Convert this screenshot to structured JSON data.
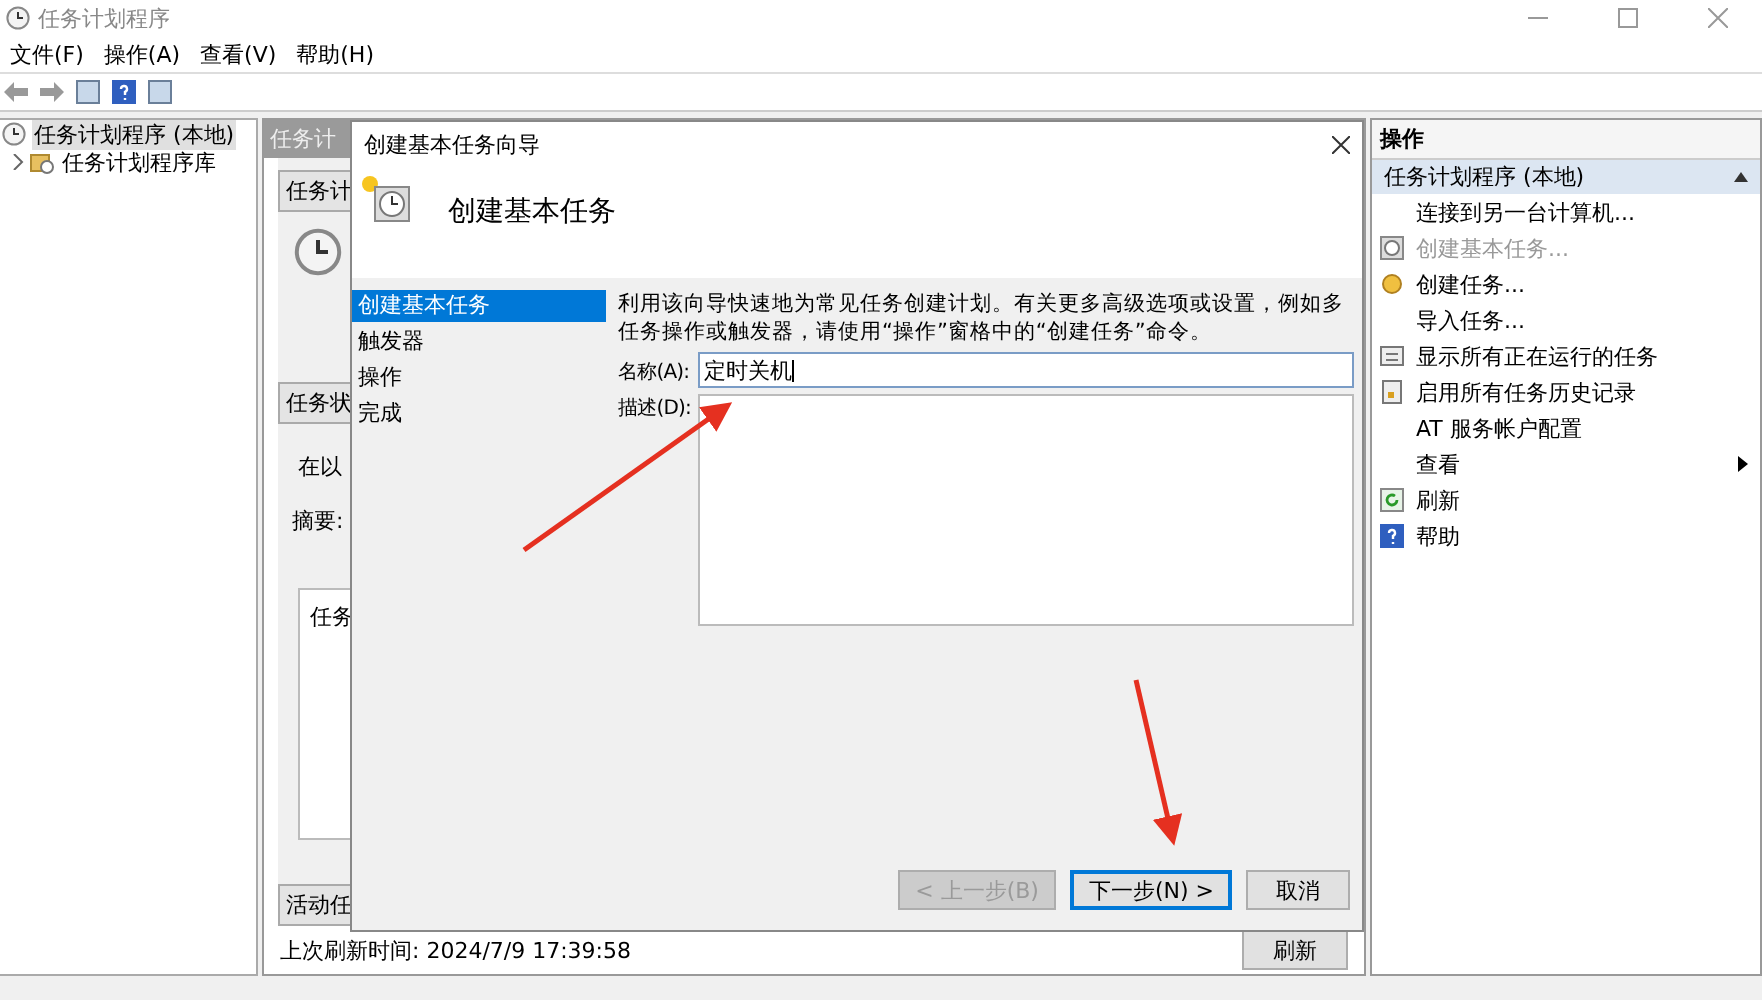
{
  "window": {
    "title": "任务计划程序"
  },
  "menu": [
    {
      "label": "文件(F)"
    },
    {
      "label": "操作(A)"
    },
    {
      "label": "查看(V)"
    },
    {
      "label": "帮助(H)"
    }
  ],
  "tree": [
    {
      "label": "任务计划程序 (本地)",
      "selected": true,
      "children": [
        {
          "label": "任务计划程序库",
          "selected": false,
          "expanded": false
        }
      ]
    }
  ],
  "middle": {
    "header": "任务计",
    "section_1": "任务计",
    "section_2": "任务状",
    "line_1": "在以",
    "summary_label": "摘要:",
    "list_text": "任务",
    "section_3": "活动任",
    "status": "上次刷新时间: 2024/7/9 17:39:58",
    "refresh_button": "刷新"
  },
  "dialog": {
    "title": "创建基本任务向导",
    "heading": "创建基本任务",
    "steps": [
      {
        "label": "创建基本任务",
        "selected": true
      },
      {
        "label": "触发器",
        "selected": false
      },
      {
        "label": "操作",
        "selected": false
      },
      {
        "label": "完成",
        "selected": false
      }
    ],
    "intro": "利用该向导快速地为常见任务创建计划。有关更多高级选项或设置，例如多任务操作或触发器，请使用“操作”窗格中的“创建任务”命令。",
    "name_label": "名称(A):",
    "name_value": "定时关机",
    "description_label": "描述(D):",
    "buttons": [
      {
        "label": "< 上一步(B)",
        "disabled": true,
        "default": false
      },
      {
        "label": "下一步(N) >",
        "disabled": false,
        "default": true
      },
      {
        "label": "取消",
        "disabled": false,
        "default": false
      }
    ]
  },
  "actions": {
    "title": "操作",
    "group": {
      "label": "任务计划程序 (本地)",
      "expanded": true
    },
    "items": [
      {
        "label": "连接到另一台计算机...",
        "disabled": false,
        "submenu": false
      },
      {
        "label": "创建基本任务...",
        "disabled": true,
        "submenu": false
      },
      {
        "label": "创建任务...",
        "disabled": false,
        "submenu": false
      },
      {
        "label": "导入任务...",
        "disabled": false,
        "submenu": false
      },
      {
        "label": "显示所有正在运行的任务",
        "disabled": false,
        "submenu": false
      },
      {
        "label": "启用所有任务历史记录",
        "disabled": false,
        "submenu": false
      },
      {
        "label": "AT 服务帐户配置",
        "disabled": false,
        "submenu": false
      },
      {
        "label": "查看",
        "disabled": false,
        "submenu": true
      },
      {
        "label": "刷新",
        "disabled": false,
        "submenu": false
      },
      {
        "label": "帮助",
        "disabled": false,
        "submenu": false
      }
    ]
  }
}
